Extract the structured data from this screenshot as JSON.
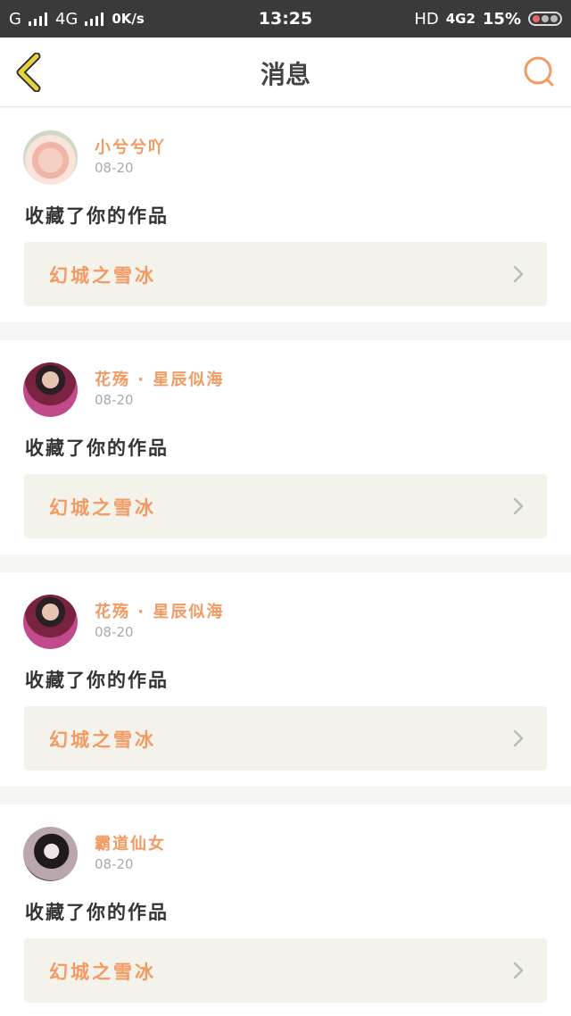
{
  "status_bar": {
    "carrier1": "G",
    "carrier2": "4G",
    "speed": "0K/s",
    "time": "13:25",
    "network_hd": "HD",
    "network_4g": "4G2",
    "battery_pct": "15%"
  },
  "header": {
    "title": "消息",
    "back_icon": "chevron-left-icon",
    "search_icon": "search-icon"
  },
  "colors": {
    "accent": "#f29a62",
    "back_icon": "#e7d23f"
  },
  "messages": [
    {
      "username": "小兮兮吖",
      "date": "08-20",
      "action": "收藏了你的作品",
      "work": "幻城之雪冰",
      "avatar": "avatar-rose"
    },
    {
      "username": "花殇 · 星辰似海",
      "date": "08-20",
      "action": "收藏了你的作品",
      "work": "幻城之雪冰",
      "avatar": "avatar-man"
    },
    {
      "username": "花殇 · 星辰似海",
      "date": "08-20",
      "action": "收藏了你的作品",
      "work": "幻城之雪冰",
      "avatar": "avatar-man"
    },
    {
      "username": "霸道仙女",
      "date": "08-20",
      "action": "收藏了你的作品",
      "work": "幻城之雪冰",
      "avatar": "avatar-girl"
    }
  ]
}
